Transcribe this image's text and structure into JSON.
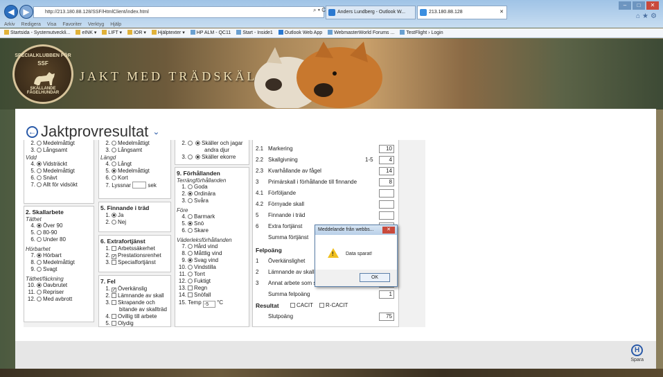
{
  "browser": {
    "url": "http://213.180.88.128/SSF/HtmlClient/index.html",
    "address_controls": "⌕ ▾ C",
    "tabs": [
      "Anders Lundberg - Outlook W...",
      "213.180.88.128"
    ],
    "menu": [
      "Arkiv",
      "Redigera",
      "Visa",
      "Favoriter",
      "Verktyg",
      "Hjälp"
    ],
    "favorites": [
      "Startsida - Systemutveckli...",
      "eINK ▾",
      "LIFT ▾",
      "IOR ▾",
      "Hjälptexter ▾",
      "HP ALM - QC11",
      "Start - Inside1",
      "Outlook Web App",
      "WebmasterWorld Forums ...",
      "TestFlight › Login"
    ]
  },
  "banner": {
    "logo_top": "SPECIALKLUBBEN FÖR",
    "logo_mid": "SSF",
    "logo_bottom": "SKÄLLANDE FÅGELHUNDAR",
    "title": "JAKT MED TRÄDSKÄLLARE"
  },
  "page": {
    "title": "Jaktprovresultat"
  },
  "form": {
    "col1_top": [
      {
        "n": "2.",
        "label": "Medelmåttigt",
        "on": false
      },
      {
        "n": "3.",
        "label": "Långsamt",
        "on": false
      }
    ],
    "vidd": {
      "label": "Vidd",
      "options": [
        {
          "n": "4.",
          "label": "Vidsträckt",
          "on": true
        },
        {
          "n": "5.",
          "label": "Medelmåttigt",
          "on": false
        },
        {
          "n": "6.",
          "label": "Snävt",
          "on": false
        },
        {
          "n": "7.",
          "label": "Allt för vidsökt",
          "on": false
        }
      ]
    },
    "skallarbete": {
      "title": "2. Skallarbete",
      "tathet": {
        "label": "Täthet",
        "options": [
          {
            "n": "4.",
            "label": "Över 90",
            "on": true
          },
          {
            "n": "5.",
            "label": "80-90",
            "on": false
          },
          {
            "n": "6.",
            "label": "Under 80",
            "on": false
          }
        ]
      },
      "horbarhet": {
        "label": "Hörbarhet",
        "options": [
          {
            "n": "7.",
            "label": "Hörbart",
            "on": true
          },
          {
            "n": "8.",
            "label": "Medelmåttigt",
            "on": false
          },
          {
            "n": "9.",
            "label": "Svagt",
            "on": false
          }
        ]
      },
      "tathet_fackning": {
        "label": "Täthet/fäckning",
        "options": [
          {
            "n": "10.",
            "label": "Oavbrutet",
            "on": true
          },
          {
            "n": "11.",
            "label": "Repriser",
            "on": false
          },
          {
            "n": "12.",
            "label": "Med avbrott",
            "on": false
          }
        ]
      }
    },
    "col2_top": [
      {
        "n": "2.",
        "label": "Medelmåttigt",
        "on": false
      },
      {
        "n": "3.",
        "label": "Långsamt",
        "on": false
      }
    ],
    "langd": {
      "label": "Längd",
      "options": [
        {
          "n": "4.",
          "label": "Långt",
          "on": false
        },
        {
          "n": "5.",
          "label": "Medelmåttigt",
          "on": true
        },
        {
          "n": "6.",
          "label": "Kort",
          "on": false
        }
      ],
      "lyssnar_n": "7.",
      "lyssnar_label": "Lyssnar",
      "lyssnar_unit": "sek"
    },
    "finnande": {
      "title": "5. Finnande i träd",
      "options": [
        {
          "n": "1.",
          "label": "Ja",
          "on": true
        },
        {
          "n": "2.",
          "label": "Nej",
          "on": false
        }
      ]
    },
    "extrafortjanst": {
      "title": "6. Extrafortjänst",
      "options": [
        {
          "n": "1.",
          "label": "Arbetssäkerhet",
          "on": false
        },
        {
          "n": "2.",
          "label": "Prestationsrenhet",
          "on": true
        },
        {
          "n": "3.",
          "label": "Specialfortjänst",
          "on": false
        }
      ]
    },
    "fel": {
      "title": "7. Fel",
      "options": [
        {
          "n": "1.",
          "label": "Överkänslig",
          "on": true
        },
        {
          "n": "2.",
          "label": "Lämnande av skall",
          "on": false
        },
        {
          "n": "3.",
          "label": "Skrapande och",
          "label2": "bitande av skallträd",
          "on": false
        },
        {
          "n": "4.",
          "label": "Ovillig till arbete",
          "on": false
        },
        {
          "n": "5.",
          "label": "Olydig",
          "on": false
        }
      ]
    },
    "col3_top": [
      {
        "n": "2.",
        "label": "Skäller och jagar",
        "label2": "andra djur",
        "on": true
      },
      {
        "n": "3.",
        "label": "Skäller ekorre",
        "on": true
      }
    ],
    "forhallanden": {
      "title": "9. Förhållanden",
      "terrang": {
        "label": "Terrängförhållanden",
        "options": [
          {
            "n": "1.",
            "label": "Goda",
            "on": false
          },
          {
            "n": "2.",
            "label": "Ordinära",
            "on": true
          },
          {
            "n": "3.",
            "label": "Svåra",
            "on": false
          }
        ]
      },
      "fore": {
        "label": "Före",
        "options": [
          {
            "n": "4.",
            "label": "Barmark",
            "on": false
          },
          {
            "n": "5.",
            "label": "Snö",
            "on": true
          },
          {
            "n": "6.",
            "label": "Skare",
            "on": false
          }
        ]
      },
      "vader": {
        "label": "Väderleksförhållanden",
        "options": [
          {
            "n": "7.",
            "label": "Hård vind",
            "on": false
          },
          {
            "n": "8.",
            "label": "Måttlig vind",
            "on": false
          },
          {
            "n": "9.",
            "label": "Svag vind",
            "on": true
          },
          {
            "n": "10.",
            "label": "Vindstilla",
            "on": false
          },
          {
            "n": "11.",
            "label": "Torrt",
            "on": false
          },
          {
            "n": "12.",
            "label": "Fuktigt",
            "on": false
          }
        ]
      },
      "checks": [
        {
          "n": "13.",
          "label": "Regn",
          "on": false
        },
        {
          "n": "14.",
          "label": "Snöfall",
          "on": false
        }
      ],
      "temp_n": "15.",
      "temp_label": "Temp",
      "temp_value": "-5",
      "temp_unit": "°C"
    },
    "scores": [
      {
        "num": "2.1",
        "label": "Markering",
        "range": "",
        "value": "10"
      },
      {
        "num": "2.2",
        "label": "Skallgivning",
        "range": "1-5",
        "value": "4"
      },
      {
        "num": "2.3",
        "label": "Kvarhållande av fågel",
        "range": "",
        "value": "14"
      },
      {
        "num": "3",
        "label": "Primärskall i förhållande till finnande",
        "range": "",
        "value": "8"
      },
      {
        "num": "4.1",
        "label": "Förföljande",
        "range": "",
        "value": ""
      },
      {
        "num": "4.2",
        "label": "Förnyade skall",
        "range": "",
        "value": ""
      },
      {
        "num": "5",
        "label": "Finnande i träd",
        "range": "",
        "value": ""
      },
      {
        "num": "6",
        "label": "Extra fortjänst",
        "range": "",
        "value": ""
      },
      {
        "num": "",
        "label": "Summa förtjänst",
        "range": "",
        "value": ""
      }
    ],
    "felpoang": {
      "title": "Felpoäng",
      "rows": [
        {
          "num": "1",
          "label": "Överkänslighet",
          "value": ""
        },
        {
          "num": "2",
          "label": "Lämnande av skall",
          "value": ""
        },
        {
          "num": "3",
          "label": "Annat arbete som stört provet",
          "value": ""
        },
        {
          "num": "",
          "label": "Summa felpoäng",
          "value": "1"
        }
      ]
    },
    "resultat": {
      "title": "Resultat",
      "cacit": "CACIT",
      "rcacit": "R-CACIT",
      "slutpoang_label": "Slutpoäng",
      "slutpoang": "75"
    }
  },
  "dialog": {
    "title": "Meddelande från webbs...",
    "close": "✕",
    "message": "Data sparat!",
    "ok": "OK"
  },
  "footer": {
    "save_label": "Spara",
    "save_icon": "H"
  },
  "colors": {
    "accent": "#2a5aa8",
    "panel": "#ffffff"
  }
}
